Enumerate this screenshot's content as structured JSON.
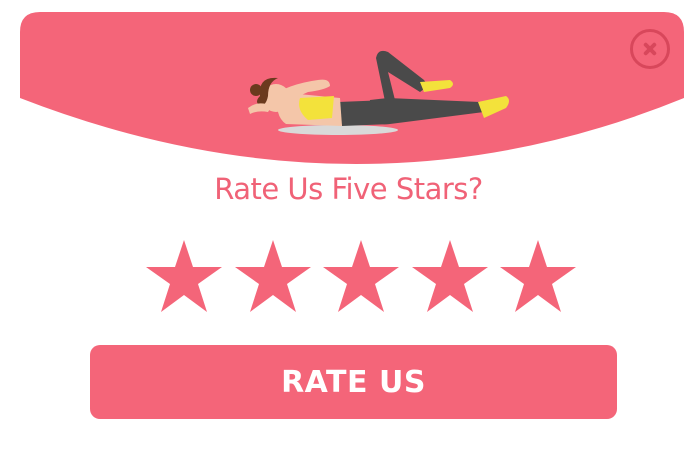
{
  "dialog": {
    "title": "Rate Us Five Stars?",
    "rating": {
      "filled": 5,
      "max": 5
    },
    "rate_button_label": "RATE US",
    "close_icon": "close-icon",
    "illustration_icon": "woman-exercising-illustration",
    "star_icon": "star-icon"
  },
  "colors": {
    "accent": "#f46579",
    "close": "#d8475b",
    "title": "#f06277",
    "background": "#ffffff"
  }
}
